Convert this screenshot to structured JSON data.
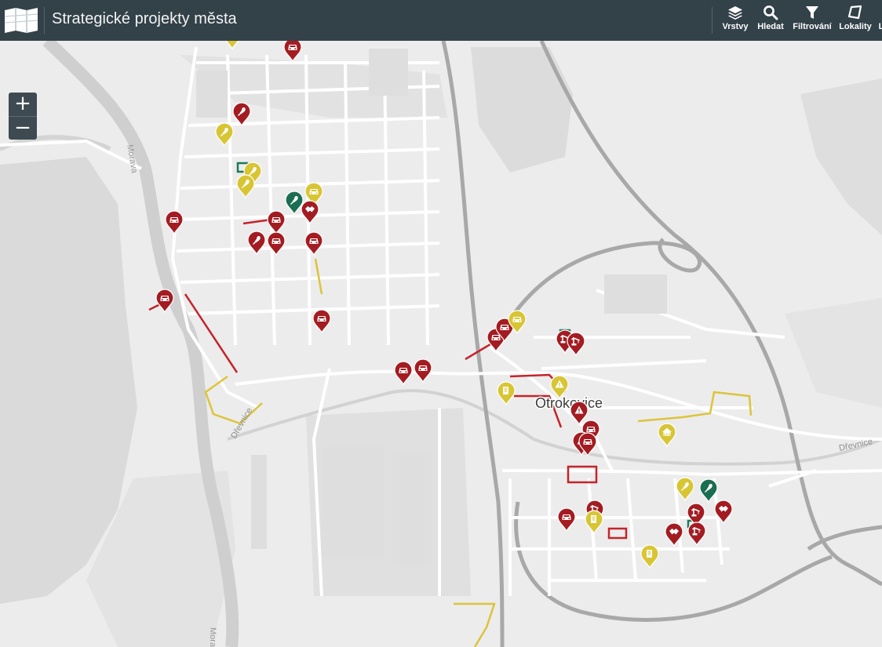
{
  "header": {
    "title": "Strategické projekty města",
    "tools": [
      {
        "label": "Vrstvy",
        "icon": "layers-icon"
      },
      {
        "label": "Hledat",
        "icon": "search-icon"
      },
      {
        "label": "Filtrování",
        "icon": "filter-icon"
      },
      {
        "label": "Lokality",
        "icon": "polygon-icon"
      },
      {
        "label": "L",
        "icon": "more-icon"
      }
    ]
  },
  "zoom": {
    "in_label": "+",
    "out_label": "−"
  },
  "map": {
    "city_label": "Otrokovice",
    "river_labels": [
      "Morava",
      "Dřevnice",
      "Dřevnice",
      "Morava"
    ],
    "colors": {
      "red": "#a31c22",
      "yellow": "#d8c534",
      "green": "#1b6e52",
      "highway": "#a4a4a4",
      "road": "#ffffff",
      "background": "#ececec",
      "water": "#d0d0d0",
      "forest": "#dadada"
    }
  },
  "markers": [
    {
      "color": "red",
      "icon": "car-icon"
    },
    {
      "color": "yellow",
      "icon": "hammer-icon"
    },
    {
      "color": "red",
      "icon": "tree-icon"
    },
    {
      "color": "yellow",
      "icon": "tree-icon"
    },
    {
      "color": "yellow",
      "icon": "tree-icon"
    },
    {
      "color": "yellow",
      "icon": "tree-icon"
    },
    {
      "color": "green",
      "icon": "tree-icon"
    },
    {
      "color": "yellow",
      "icon": "car-icon"
    },
    {
      "color": "red",
      "icon": "car-icon"
    },
    {
      "color": "red",
      "icon": "handshake-icon"
    },
    {
      "color": "red",
      "icon": "car-icon"
    },
    {
      "color": "red",
      "icon": "tree-icon"
    },
    {
      "color": "red",
      "icon": "car-icon"
    },
    {
      "color": "red",
      "icon": "car-icon"
    },
    {
      "color": "red",
      "icon": "car-icon"
    },
    {
      "color": "red",
      "icon": "car-icon"
    },
    {
      "color": "red",
      "icon": "car-icon"
    },
    {
      "color": "red",
      "icon": "car-icon"
    },
    {
      "color": "red",
      "icon": "car-icon"
    },
    {
      "color": "red",
      "icon": "car-icon"
    },
    {
      "color": "yellow",
      "icon": "car-icon"
    },
    {
      "color": "red",
      "icon": "crane-icon"
    },
    {
      "color": "red",
      "icon": "crane-icon"
    },
    {
      "color": "yellow",
      "icon": "warning-icon"
    },
    {
      "color": "yellow",
      "icon": "building-icon"
    },
    {
      "color": "red",
      "icon": "warning-icon"
    },
    {
      "color": "red",
      "icon": "car-icon"
    },
    {
      "color": "red",
      "icon": "warning-icon"
    },
    {
      "color": "red",
      "icon": "car-icon"
    },
    {
      "color": "yellow",
      "icon": "house-icon"
    },
    {
      "color": "yellow",
      "icon": "tree-icon"
    },
    {
      "color": "green",
      "icon": "tree-icon"
    },
    {
      "color": "red",
      "icon": "handshake-icon"
    },
    {
      "color": "red",
      "icon": "crane-icon"
    },
    {
      "color": "red",
      "icon": "handshake-icon"
    },
    {
      "color": "red",
      "icon": "crane-icon"
    },
    {
      "color": "red",
      "icon": "car-icon"
    },
    {
      "color": "red",
      "icon": "crane-icon"
    },
    {
      "color": "yellow",
      "icon": "building-icon"
    },
    {
      "color": "yellow",
      "icon": "building-icon"
    }
  ]
}
